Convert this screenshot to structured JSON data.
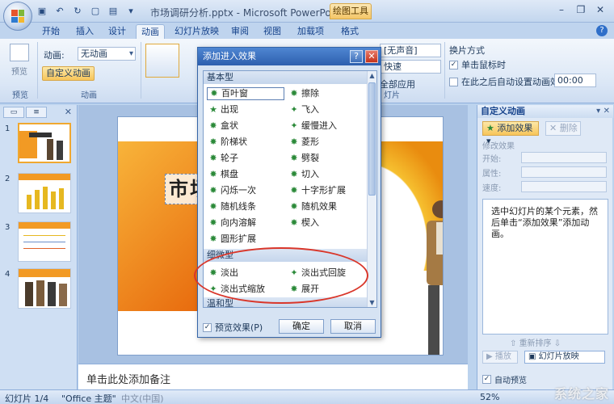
{
  "window": {
    "title": "市场调研分析.pptx - Microsoft PowerPoint",
    "contextual_tab_title": "绘图工具"
  },
  "ribbon_tabs": [
    "开始",
    "插入",
    "设计",
    "动画",
    "幻灯片放映",
    "审阅",
    "视图",
    "加载项",
    "格式"
  ],
  "active_tab": "动画",
  "ribbon": {
    "preview_label": "预览",
    "preview_group": "预览",
    "animation_label": "动画:",
    "animation_value": "无动画",
    "custom_animation_label": "自定义动画",
    "animation_group": "动画",
    "sound_value": "[无声音]",
    "speed_value": "快速",
    "apply_all": "全部应用",
    "switch_title": "换片方式",
    "on_click_label": "单击鼠标时",
    "after_label": "在此之后自动设置动画效果:",
    "after_time": "00:00",
    "slides_group_fragment": "灯片"
  },
  "slides": [
    {
      "num": "1"
    },
    {
      "num": "2"
    },
    {
      "num": "3"
    },
    {
      "num": "4"
    }
  ],
  "slide": {
    "title_text": "市场调"
  },
  "notes_placeholder": "单击此处添加备注",
  "task_pane": {
    "title": "自定义动画",
    "add_effect": "添加效果",
    "remove": "删除",
    "modify_section": "修改效果",
    "start_label": "开始:",
    "property_label": "属性:",
    "speed_label": "速度:",
    "info_text": "选中幻灯片的某个元素，然后单击“添加效果”添加动画。",
    "reorder_label": "重新排序",
    "play_label": "播放",
    "slideshow_label": "幻灯片放映",
    "autopreview_label": "自动预览"
  },
  "dialog": {
    "title": "添加进入效果",
    "categories": [
      {
        "name": "基本型",
        "left": [
          "百叶窗",
          "出现",
          "盒状",
          "阶梯状",
          "轮子",
          "棋盘",
          "闪烁一次",
          "随机线条",
          "向内溶解",
          "圆形扩展"
        ],
        "right": [
          "擦除",
          "飞入",
          "缓慢进入",
          "菱形",
          "劈裂",
          "切入",
          "十字形扩展",
          "随机效果",
          "楔入"
        ]
      },
      {
        "name": "细微型",
        "left": [
          "淡出",
          "淡出式缩放"
        ],
        "right": [
          "淡出式回旋",
          "展开"
        ]
      },
      {
        "name": "温和型",
        "left": [],
        "right": []
      }
    ],
    "selected_effect": "百叶窗",
    "preview_label": "预览效果(P)",
    "ok_label": "确定",
    "cancel_label": "取消"
  },
  "status": {
    "slide_info": "幻灯片 1/4",
    "theme": "\"Office 主题\"",
    "language": "中文(中国)",
    "zoom": "52%"
  },
  "watermark": "系统之家"
}
